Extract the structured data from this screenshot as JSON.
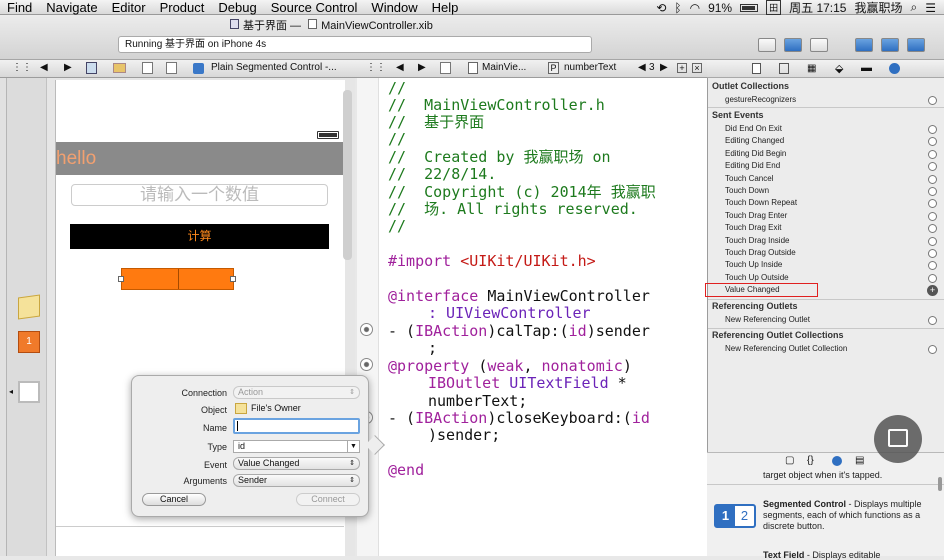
{
  "menubar": {
    "items": [
      "Find",
      "Navigate",
      "Editor",
      "Product",
      "Debug",
      "Source Control",
      "Window",
      "Help"
    ],
    "battery": "91%",
    "clock": "周五 17:15",
    "user": "我赢职场"
  },
  "window": {
    "title_project": "基于界面 —",
    "title_file": "MainViewController.xib",
    "status": "Running 基于界面 on iPhone 4s"
  },
  "jumpbar": {
    "left_crumb": "Plain Segmented Control -...",
    "right_crumb_file": "MainVie...",
    "right_crumb_symbol": "numberText",
    "counter": "3"
  },
  "canvas": {
    "nav_title": "hello",
    "text_field_placeholder": "请输入一个数值",
    "calc_button": "计算"
  },
  "code": {
    "lines": [
      [
        "//",
        ""
      ],
      [
        "//  MainViewController.h",
        ""
      ],
      [
        "//  基于界面",
        ""
      ],
      [
        "//",
        ""
      ],
      [
        "//  Created by 我赢职场 on",
        ""
      ],
      [
        "//  22/8/14.",
        ""
      ],
      [
        "//  Copyright (c) 2014年 我赢职",
        ""
      ],
      [
        "//  场. All rights reserved.",
        ""
      ],
      [
        "//",
        ""
      ]
    ],
    "import_kw": "#import",
    "import_path": "<UIKit/UIKit.h>",
    "interface_kw": "@interface",
    "interface_name": "MainViewController",
    "superclass": ": UIViewController",
    "calTap": [
      "- (",
      "IBAction",
      ")calTap:(",
      "id",
      ")sender"
    ],
    "semicolon": ";",
    "property_kw": "@property",
    "property_attrs": [
      "(",
      "weak",
      ", ",
      "nonatomic",
      ")"
    ],
    "outlet_line": [
      "IBOutlet ",
      "UITextField",
      " *"
    ],
    "number_text": "numberText;",
    "closeKeyboard": [
      "- (",
      "IBAction",
      ")closeKeyboard:(",
      "id"
    ],
    "sender_line": ")sender;",
    "end_kw": "@end"
  },
  "inspector": {
    "outlet_collections_header": "Outlet Collections",
    "outlet_collections": [
      "gestureRecognizers"
    ],
    "sent_events_header": "Sent Events",
    "sent_events": [
      "Did End On Exit",
      "Editing Changed",
      "Editing Did Begin",
      "Editing Did End",
      "Touch Cancel",
      "Touch Down",
      "Touch Down Repeat",
      "Touch Drag Enter",
      "Touch Drag Exit",
      "Touch Drag Inside",
      "Touch Drag Outside",
      "Touch Up Inside",
      "Touch Up Outside",
      "Value Changed"
    ],
    "ref_outlets_header": "Referencing Outlets",
    "ref_outlets": [
      "New Referencing Outlet"
    ],
    "ref_collections_header": "Referencing Outlet Collections",
    "ref_collections": [
      "New Referencing Outlet Collection"
    ],
    "highlight_color": "#e02020"
  },
  "library": {
    "prev_desc": "target object when it's tapped.",
    "segmented_title": "Segmented Control",
    "segmented_desc": " - Displays multiple segments, each of which functions as a discrete button.",
    "seg_icon_1": "1",
    "seg_icon_2": "2",
    "next_title": "Text Field",
    "next_desc": " - Displays editable"
  },
  "popup": {
    "connection_label": "Connection",
    "connection_value": "Action",
    "object_label": "Object",
    "object_value": "File's Owner",
    "name_label": "Name",
    "name_value": "",
    "type_label": "Type",
    "type_value": "id",
    "event_label": "Event",
    "event_value": "Value Changed",
    "arguments_label": "Arguments",
    "arguments_value": "Sender",
    "cancel": "Cancel",
    "connect": "Connect"
  },
  "colors": {
    "nav_bar": "#8a8a8a",
    "nav_title": "#f2a070",
    "calc_bg": "#000000",
    "calc_text": "#ff8a1c",
    "segment": "#ff7a10"
  }
}
